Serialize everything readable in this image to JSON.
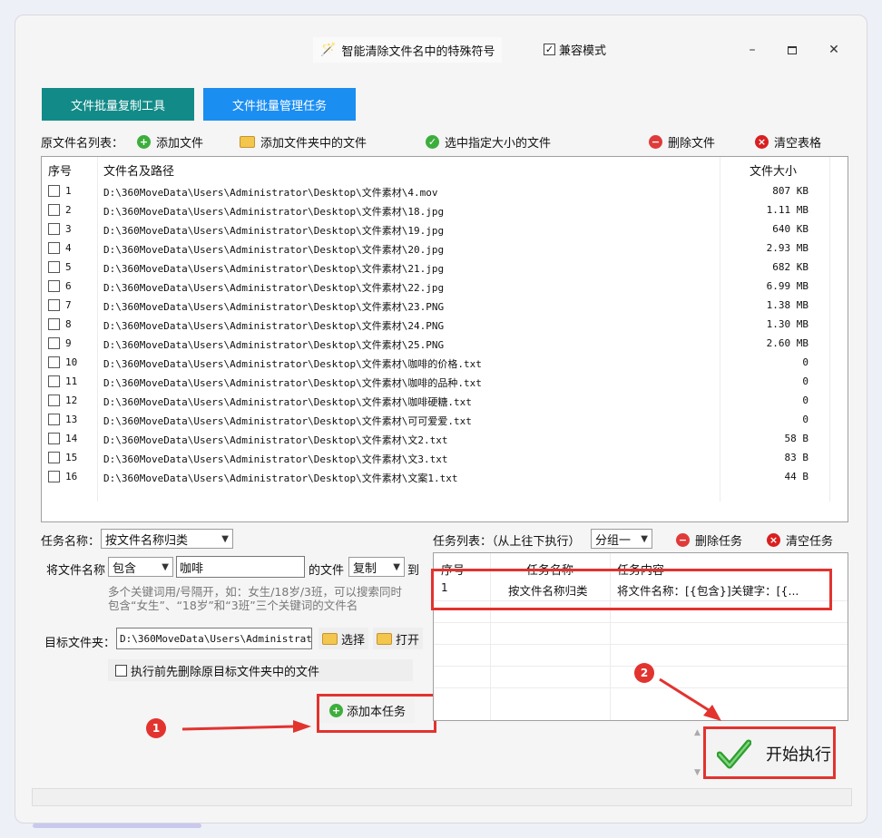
{
  "title": {
    "app_name": "智能清除文件名中的特殊符号",
    "compat_label": "兼容模式",
    "compat_checked": true,
    "min": "–",
    "max": "☐",
    "close": "✕"
  },
  "tabs": [
    {
      "label": "文件批量复制工具",
      "color": "#128b88"
    },
    {
      "label": "文件批量管理任务",
      "color": "#1b8ef2"
    }
  ],
  "toolbar": {
    "label": "原文件名列表：",
    "add_file": "添加文件",
    "add_folder": "添加文件夹中的文件",
    "select_size": "选中指定大小的文件",
    "delete_file": "删除文件",
    "clear_table": "清空表格"
  },
  "file_list": {
    "headers": {
      "index": "序号",
      "path": "文件名及路径",
      "size": "文件大小"
    },
    "rows": [
      {
        "index": "1",
        "path": "D:\\360MoveData\\Users\\Administrator\\Desktop\\文件素材\\4.mov",
        "size": "807 KB"
      },
      {
        "index": "2",
        "path": "D:\\360MoveData\\Users\\Administrator\\Desktop\\文件素材\\18.jpg",
        "size": "1.11 MB"
      },
      {
        "index": "3",
        "path": "D:\\360MoveData\\Users\\Administrator\\Desktop\\文件素材\\19.jpg",
        "size": "640 KB"
      },
      {
        "index": "4",
        "path": "D:\\360MoveData\\Users\\Administrator\\Desktop\\文件素材\\20.jpg",
        "size": "2.93 MB"
      },
      {
        "index": "5",
        "path": "D:\\360MoveData\\Users\\Administrator\\Desktop\\文件素材\\21.jpg",
        "size": "682 KB"
      },
      {
        "index": "6",
        "path": "D:\\360MoveData\\Users\\Administrator\\Desktop\\文件素材\\22.jpg",
        "size": "6.99 MB"
      },
      {
        "index": "7",
        "path": "D:\\360MoveData\\Users\\Administrator\\Desktop\\文件素材\\23.PNG",
        "size": "1.38 MB"
      },
      {
        "index": "8",
        "path": "D:\\360MoveData\\Users\\Administrator\\Desktop\\文件素材\\24.PNG",
        "size": "1.30 MB"
      },
      {
        "index": "9",
        "path": "D:\\360MoveData\\Users\\Administrator\\Desktop\\文件素材\\25.PNG",
        "size": "2.60 MB"
      },
      {
        "index": "10",
        "path": "D:\\360MoveData\\Users\\Administrator\\Desktop\\文件素材\\咖啡的价格.txt",
        "size": "0"
      },
      {
        "index": "11",
        "path": "D:\\360MoveData\\Users\\Administrator\\Desktop\\文件素材\\咖啡的品种.txt",
        "size": "0"
      },
      {
        "index": "12",
        "path": "D:\\360MoveData\\Users\\Administrator\\Desktop\\文件素材\\咖啡硬糖.txt",
        "size": "0"
      },
      {
        "index": "13",
        "path": "D:\\360MoveData\\Users\\Administrator\\Desktop\\文件素材\\可可爱爱.txt",
        "size": "0"
      },
      {
        "index": "14",
        "path": "D:\\360MoveData\\Users\\Administrator\\Desktop\\文件素材\\文2.txt",
        "size": "58 B"
      },
      {
        "index": "15",
        "path": "D:\\360MoveData\\Users\\Administrator\\Desktop\\文件素材\\文3.txt",
        "size": "83 B"
      },
      {
        "index": "16",
        "path": "D:\\360MoveData\\Users\\Administrator\\Desktop\\文件素材\\文案1.txt",
        "size": "44 B"
      }
    ]
  },
  "task_form": {
    "task_name_label": "任务名称：",
    "task_name_value": "按文件名称归类",
    "rule_prefix": "将文件名称",
    "match_mode": "包含",
    "keyword": "咖啡",
    "rule_mid": "的文件",
    "action": "复制",
    "rule_suffix": "到",
    "hint_line1": "多个关键词用/号隔开，如：女生/18岁/3班，可以搜索同时",
    "hint_line2": "包含“女生”、“18岁”和“3班”三个关键词的文件名",
    "target_label": "目标文件夹：",
    "target_value": "D:\\360MoveData\\Users\\Administrat",
    "choose_btn": "选择",
    "open_btn": "打开",
    "delete_before_label": "执行前先删除原目标文件夹中的文件",
    "add_task_btn": "添加本任务"
  },
  "task_panel": {
    "label": "任务列表：（从上往下执行）",
    "group_value": "分组一",
    "delete_task": "删除任务",
    "clear_task": "清空任务",
    "headers": {
      "index": "序号",
      "name": "任务名称",
      "content": "任务内容"
    },
    "rows": [
      {
        "index": "1",
        "name": "按文件名称归类",
        "content": "将文件名称：[{包含}]关键字：[{..."
      }
    ]
  },
  "annotations": {
    "step1": "1",
    "step2": "2",
    "highlight_color": "#e2332f"
  },
  "start_button": "开始执行"
}
